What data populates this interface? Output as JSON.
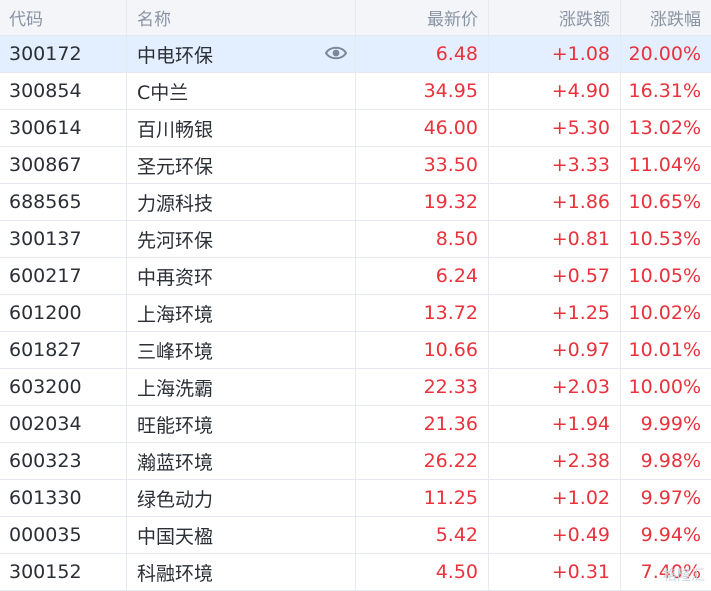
{
  "header": {
    "code": "代码",
    "name": "名称",
    "price": "最新价",
    "change": "涨跌额",
    "change_pct": "涨跌幅"
  },
  "colors": {
    "up": "#e8323c",
    "header_bg": "#f3f5f9",
    "selected_bg": "#e3efff"
  },
  "rows": [
    {
      "code": "300172",
      "name": "中电环保",
      "price": "6.48",
      "change": "+1.08",
      "pct": "20.00%"
    },
    {
      "code": "300854",
      "name": "C中兰",
      "price": "34.95",
      "change": "+4.90",
      "pct": "16.31%"
    },
    {
      "code": "300614",
      "name": "百川畅银",
      "price": "46.00",
      "change": "+5.30",
      "pct": "13.02%"
    },
    {
      "code": "300867",
      "name": "圣元环保",
      "price": "33.50",
      "change": "+3.33",
      "pct": "11.04%"
    },
    {
      "code": "688565",
      "name": "力源科技",
      "price": "19.32",
      "change": "+1.86",
      "pct": "10.65%"
    },
    {
      "code": "300137",
      "name": "先河环保",
      "price": "8.50",
      "change": "+0.81",
      "pct": "10.53%"
    },
    {
      "code": "600217",
      "name": "中再资环",
      "price": "6.24",
      "change": "+0.57",
      "pct": "10.05%"
    },
    {
      "code": "601200",
      "name": "上海环境",
      "price": "13.72",
      "change": "+1.25",
      "pct": "10.02%"
    },
    {
      "code": "601827",
      "name": "三峰环境",
      "price": "10.66",
      "change": "+0.97",
      "pct": "10.01%"
    },
    {
      "code": "603200",
      "name": "上海洗霸",
      "price": "22.33",
      "change": "+2.03",
      "pct": "10.00%"
    },
    {
      "code": "002034",
      "name": "旺能环境",
      "price": "21.36",
      "change": "+1.94",
      "pct": "9.99%"
    },
    {
      "code": "600323",
      "name": "瀚蓝环境",
      "price": "26.22",
      "change": "+2.38",
      "pct": "9.98%"
    },
    {
      "code": "601330",
      "name": "绿色动力",
      "price": "11.25",
      "change": "+1.02",
      "pct": "9.97%"
    },
    {
      "code": "000035",
      "name": "中国天楹",
      "price": "5.42",
      "change": "+0.49",
      "pct": "9.94%"
    },
    {
      "code": "300152",
      "name": "科融环境",
      "price": "4.50",
      "change": "+0.31",
      "pct": "7.40%"
    }
  ],
  "watermark": "格隆汇"
}
